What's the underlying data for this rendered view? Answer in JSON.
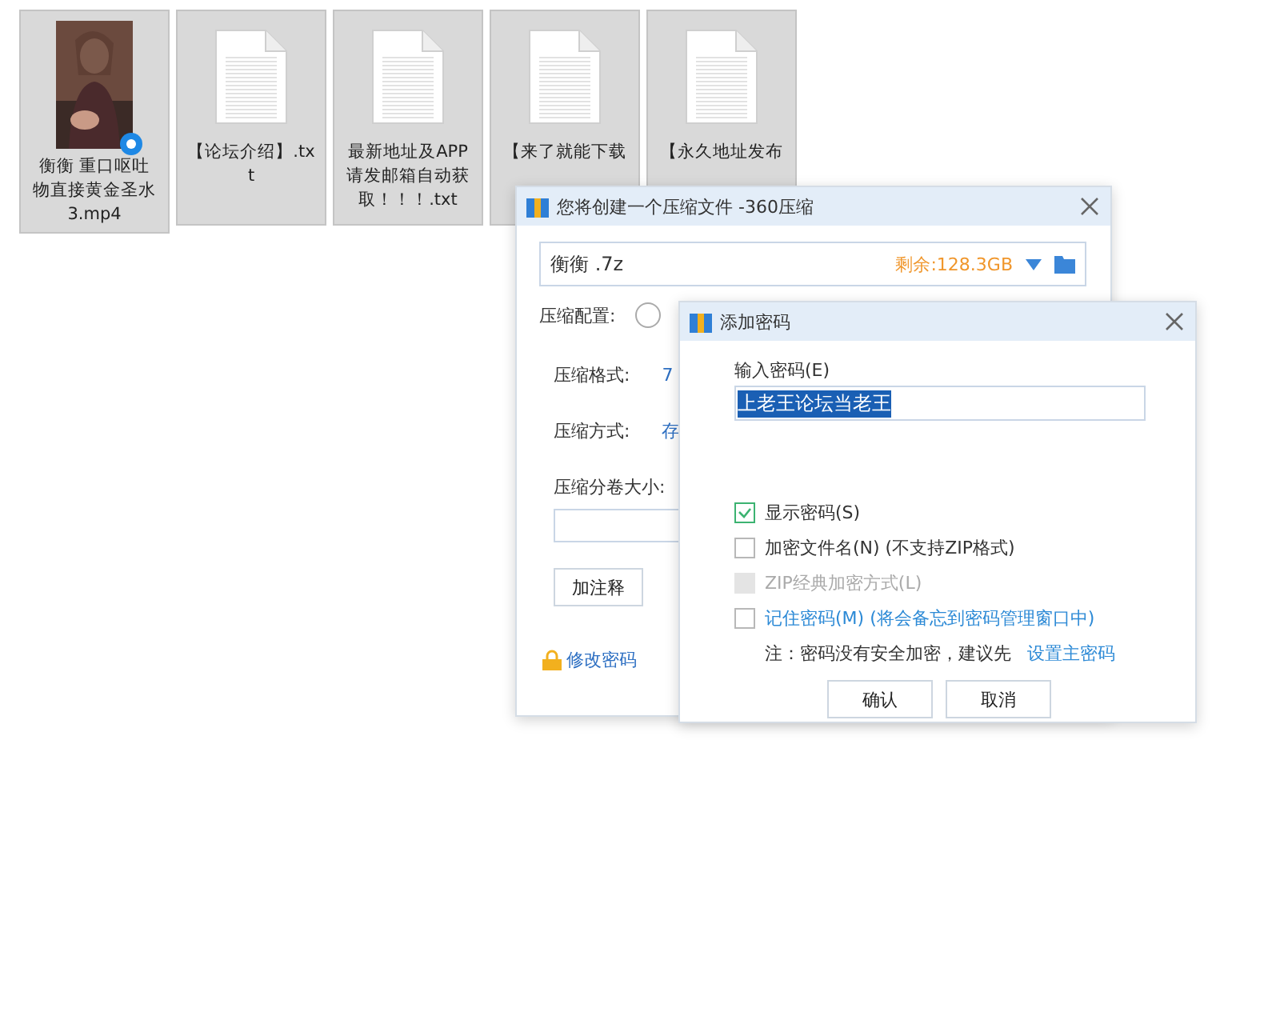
{
  "files": [
    {
      "kind": "video",
      "name": "衡衡 重口呕吐物直接黄金圣水3.mp4"
    },
    {
      "kind": "text",
      "name": "【论坛介绍】.txt"
    },
    {
      "kind": "text",
      "name": "最新地址及APP请发邮箱自动获取！！！.txt"
    },
    {
      "kind": "text",
      "name": "【来了就能下载"
    },
    {
      "kind": "text",
      "name": "【永久地址发布"
    }
  ],
  "compress_dialog": {
    "title": "您将创建一个压缩文件 -360压缩",
    "filename": "衡衡 .7z",
    "free_space": "剩余:128.3GB",
    "config_label": "压缩配置:",
    "config_selected": false,
    "rows": [
      {
        "label": "压缩格式:",
        "value": "7"
      },
      {
        "label": "压缩方式:",
        "value": "存"
      }
    ],
    "split_label": "压缩分卷大小:",
    "comment_button": "加注释",
    "password_link": "修改密码"
  },
  "password_dialog": {
    "title": "添加密码",
    "input_label": "输入密码(E)",
    "password": "上老王论坛当老王",
    "options": [
      {
        "kind": "plain",
        "label": "显示密码(S)",
        "checked": true,
        "disabled": false
      },
      {
        "kind": "plain",
        "label": "加密文件名(N) (不支持ZIP格式)",
        "checked": false,
        "disabled": false
      },
      {
        "kind": "plain",
        "label": "ZIP经典加密方式(L)",
        "checked": false,
        "disabled": true
      },
      {
        "kind": "link",
        "label": "记住密码(M) (将会备忘到密码管理窗口中)",
        "checked": false,
        "disabled": false
      }
    ],
    "note": "注：密码没有安全加密，建议先",
    "note_link": "设置主密码",
    "buttons": [
      "确认",
      "取消"
    ]
  }
}
